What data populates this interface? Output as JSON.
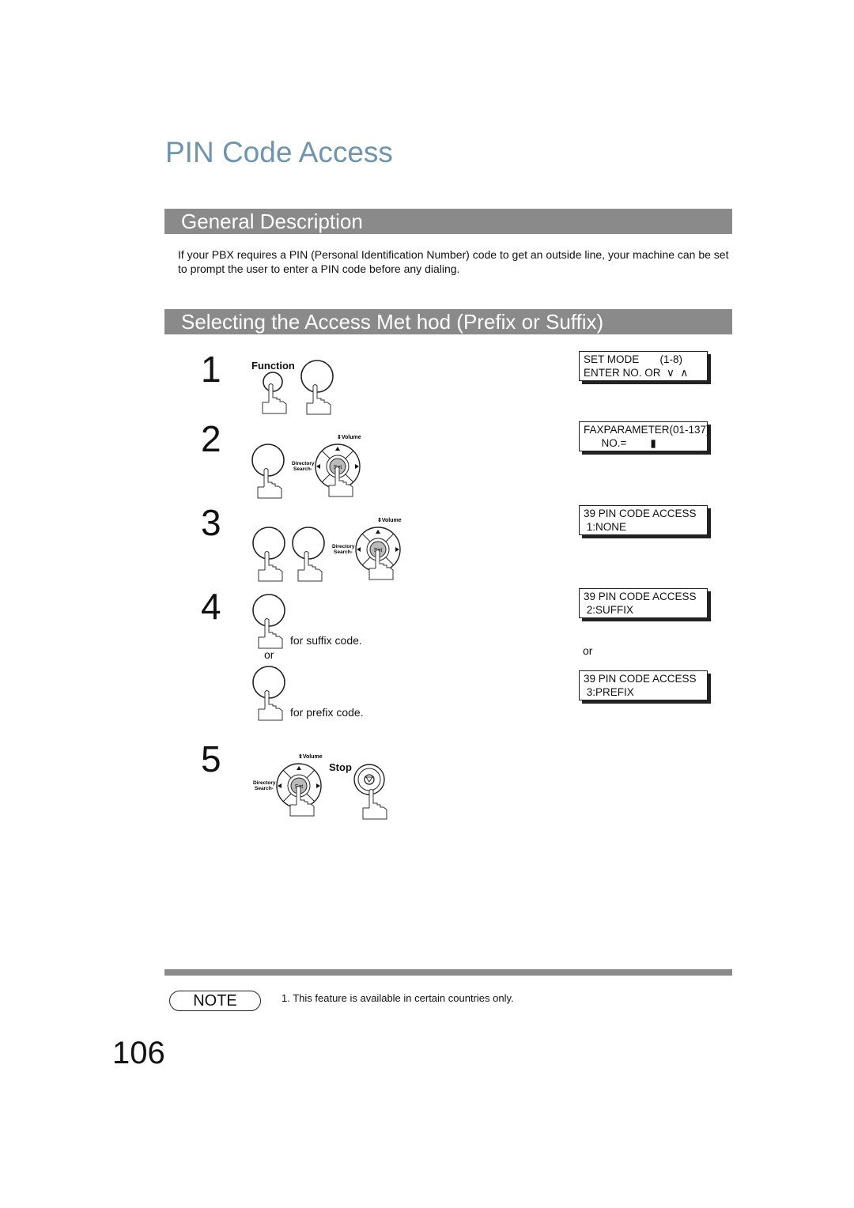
{
  "title": "PIN Code Access",
  "sections": {
    "general": "General Description",
    "selecting": "Selecting the Access Met   hod (Prefix or Suffix)"
  },
  "description": "If your PBX requires a PIN (Personal Identification Number) code to get an outside line, your machine can be set to prompt the user to enter a PIN code before any dialing.",
  "steps": {
    "s1": "1",
    "s2": "2",
    "s3": "3",
    "s4": "4",
    "s5": "5"
  },
  "buttons": {
    "function": "Function",
    "stop": "Stop",
    "volume": "Volume",
    "directory": "Directory",
    "search": "Search",
    "set": "Set"
  },
  "step4": {
    "suffix": "for suffix code.",
    "or": "or",
    "prefix": "for prefix code."
  },
  "lcd": {
    "l1a": "SET MODE       (1-8)",
    "l1b": "ENTER NO. OR  ∨  ∧",
    "l2a": "FAXPARAMETER(01-137)",
    "l2b": "      NO.=        ▮",
    "l3a": "39 PIN CODE ACCESS",
    "l3b": " 1:NONE",
    "l4a": "39 PIN CODE ACCESS",
    "l4b": " 2:SUFFIX",
    "or": "or",
    "l5a": "39 PIN CODE ACCESS",
    "l5b": " 3:PREFIX"
  },
  "note": {
    "label": "NOTE",
    "text": "1.  This feature is available in certain countries only."
  },
  "page_number": "106"
}
